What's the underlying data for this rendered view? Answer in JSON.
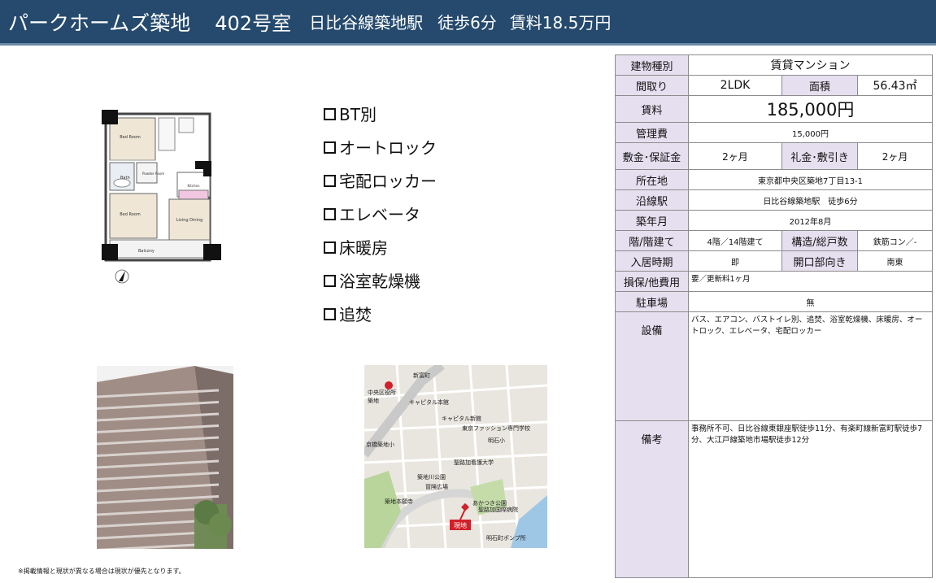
{
  "header": {
    "name": "パークホームズ築地",
    "room": "402号室",
    "line_station": "日比谷線築地駅",
    "walk": "徒歩6分",
    "rent": "賃料18.5万円"
  },
  "features": [
    "BT別",
    "オートロック",
    "宅配ロッカー",
    "エレベータ",
    "床暖房",
    "浴室乾燥機",
    "追焚"
  ],
  "floorplan": {
    "rooms": [
      "Bed Room",
      "Bath",
      "Powder Room",
      "Bed Room",
      "Kitchen",
      "Living Dining",
      "Balcony"
    ]
  },
  "map": {
    "labels": [
      "中央区役所",
      "築地",
      "キャピタル新館",
      "キャピタル本館",
      "キャピタル新館",
      "東京ファッション専門学校",
      "京橋築地小",
      "明石小",
      "聖路加看護大学",
      "築地川公園",
      "冒険広場",
      "築地本願寺",
      "あかつき公園",
      "聖路加国際病院",
      "東京都立",
      "現地",
      "明石町ポンプ所",
      "新富町"
    ],
    "here_label": "現地"
  },
  "spec": {
    "type_label": "建物種別",
    "type_value": "賃貸マンション",
    "layout_label": "間取り",
    "layout_value": "2LDK",
    "area_label": "面積",
    "area_value": "56.43㎡",
    "rent_label": "賃料",
    "rent_value": "185,000円",
    "fee_label": "管理費",
    "fee_value": "15,000円",
    "deposit_label": "敷金･保証金",
    "deposit_value": "2ヶ月",
    "keymoney_label": "礼金･敷引き",
    "keymoney_value": "2ヶ月",
    "address_label": "所在地",
    "address_value": "東京都中央区築地7丁目13-1",
    "station_label": "沿線駅",
    "station_value": "日比谷線築地駅　徒歩6分",
    "built_label": "築年月",
    "built_value": "2012年8月",
    "floor_label": "階/階建て",
    "floor_value": "4階／14階建て",
    "structure_label": "構造/総戸数",
    "structure_value": "鉄筋コン／-",
    "movein_label": "入居時期",
    "movein_value": "即",
    "facing_label": "開口部向き",
    "facing_value": "南東",
    "insurance_label": "損保/他費用",
    "insurance_value": "要／更新料1ヶ月",
    "parking_label": "駐車場",
    "parking_value": "無",
    "equip_label": "設備",
    "equip_value": "バス、エアコン、バストイレ別、追焚、浴室乾燥機、床暖房、オートロック、エレベータ、宅配ロッカー",
    "notes_label": "備考",
    "notes_value": "事務所不可、日比谷線東銀座駅徒歩11分、有楽町線新富町駅徒歩7分、大江戸線築地市場駅徒歩12分"
  },
  "footnote": "※掲載情報と現状が異なる場合は現状が優先となります。",
  "colors": {
    "header_bg": "#254a6d",
    "label_bg": "#e6dff0"
  }
}
